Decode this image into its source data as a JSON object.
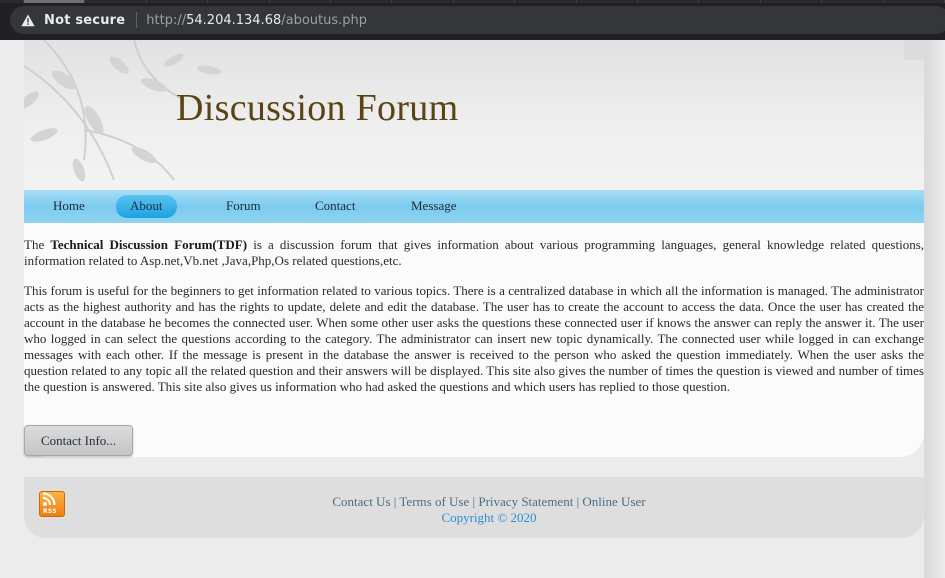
{
  "browser": {
    "security_label": "Not secure",
    "url_scheme": "http://",
    "url_host": "54.204.134.68",
    "url_path": "/aboutus.php"
  },
  "site": {
    "title": "Discussion Forum"
  },
  "nav": {
    "items": [
      {
        "label": "Home"
      },
      {
        "label": "About",
        "active": true
      },
      {
        "label": "Forum"
      },
      {
        "label": "Contact"
      },
      {
        "label": "Message"
      }
    ]
  },
  "about": {
    "intro_prefix": "The",
    "intro_bold": "Technical Discussion Forum(TDF)",
    "intro_rest": "is a discussion forum that gives information about various programming languages, general knowledge related questions, information related to Asp.net,Vb.net ,Java,Php,Os related questions,etc.",
    "body": "This forum is useful for the beginners to get information related to various topics. There is a centralized database in which all the information is managed. The administrator acts as the highest authority and has the rights to update, delete and edit the database. The user has to create the account to access the data. Once the user has created the account in the database he becomes the connected user. When some other user asks the questions these connected user if knows the answer can reply the answer it. The user who logged in can select the questions according to the category. The administrator can insert new topic dynamically. The connected user while logged in can exchange messages with each other. If the message is present in the database the answer is received to the person who asked the question immediately. When the user asks the question related to any topic all the related question and their answers will be displayed. This site also gives the number of times the question is viewed and number of times the question is answered. This site also gives us information who had asked the questions and which users has replied to those question.",
    "contact_button": "Contact Info..."
  },
  "footer": {
    "rss_label": "RSS",
    "links": [
      "Contact Us",
      "Terms of Use",
      "Privacy Statement",
      "Online User"
    ],
    "separator": "|",
    "copyright": "Copyright © 2020"
  },
  "colors": {
    "title": "#5a4414",
    "nav_bg": "#8fd3f1",
    "nav_active": "#1ca3e3",
    "footer_link": "#4a6d86",
    "copyright": "#2a8fd6"
  }
}
